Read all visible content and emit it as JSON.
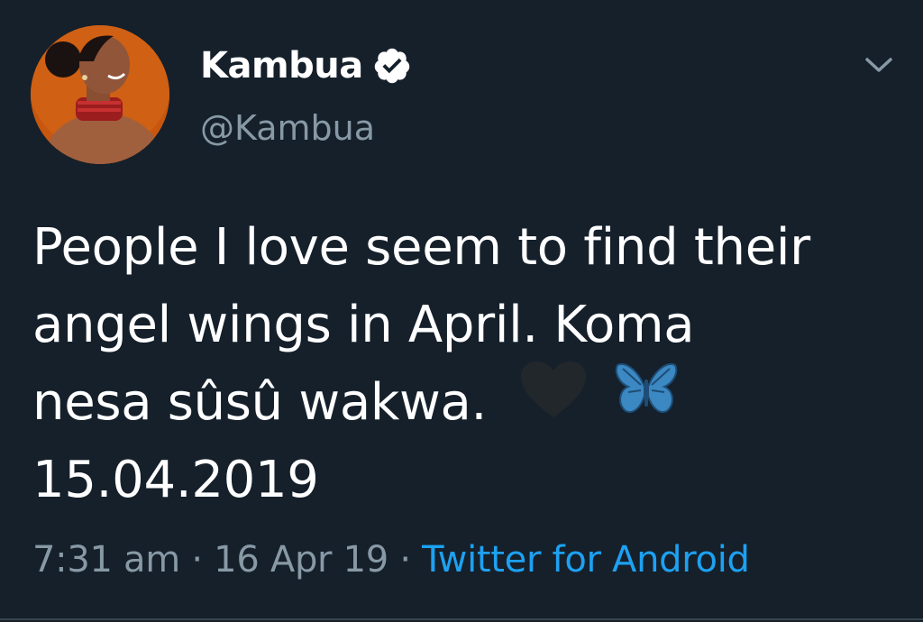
{
  "user": {
    "display_name": "Kambua",
    "handle": "@Kambua",
    "verified": true,
    "avatar": "profile-photo"
  },
  "tweet": {
    "lines": [
      "People I love seem to find their",
      "angel wings in April. Koma",
      "nesa sûsû wakwa.",
      "15.04.2019"
    ],
    "emojis": [
      "black-heart-emoji",
      "butterfly-emoji"
    ]
  },
  "meta": {
    "time": "7:31 am",
    "separator": " · ",
    "date": "16 Apr 19",
    "source": "Twitter for Android"
  },
  "colors": {
    "background": "#15202b",
    "text": "#ffffff",
    "secondary": "#8899a6",
    "link": "#1da1f2"
  },
  "icons": [
    "verified-badge-icon",
    "chevron-down-icon"
  ]
}
